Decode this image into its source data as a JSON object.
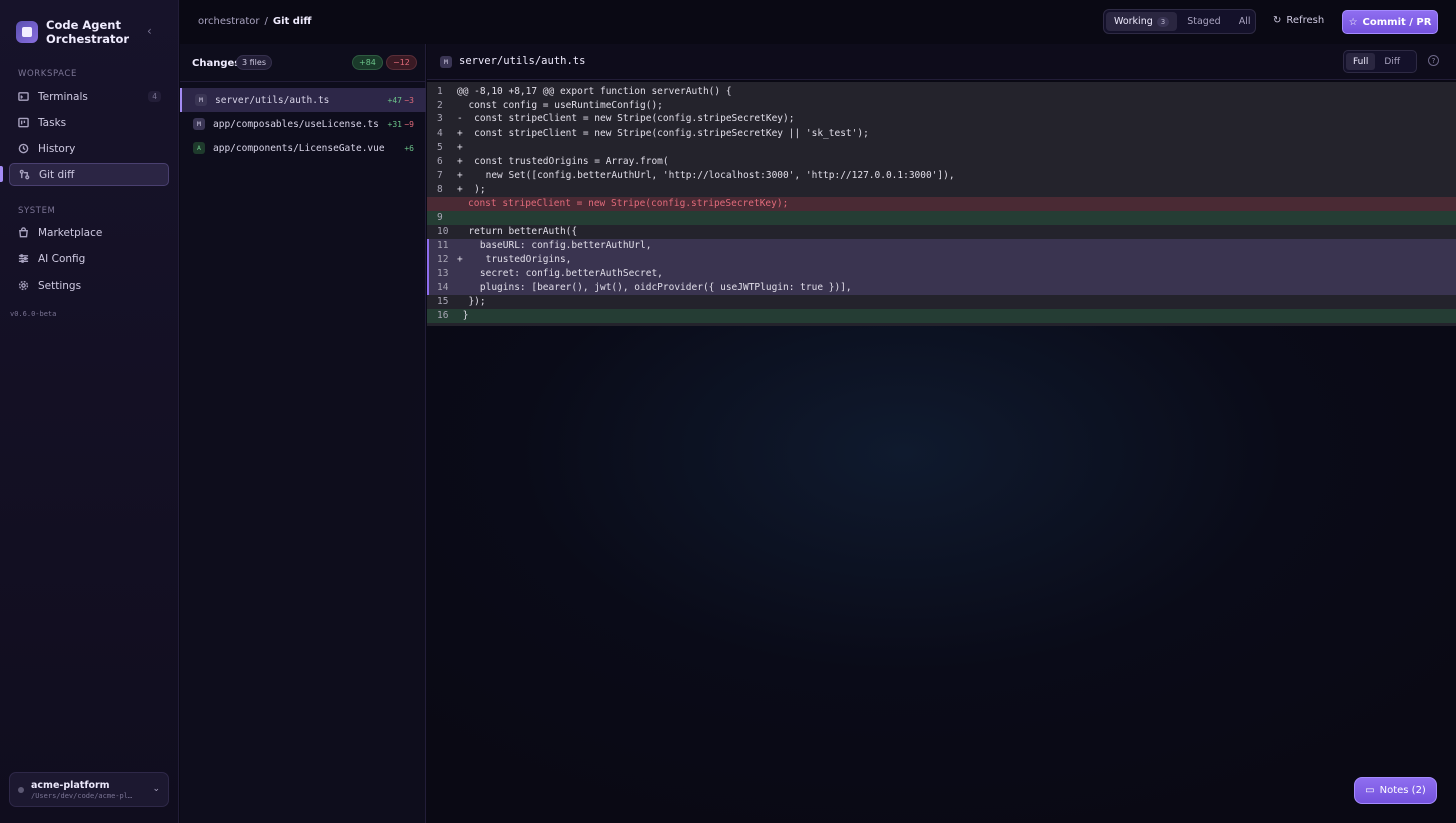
{
  "brand": {
    "name": "Code Agent Orchestrator"
  },
  "sidebar": {
    "workspace_label": "WORKSPACE",
    "system_label": "SYSTEM",
    "items": [
      {
        "label": "Terminals",
        "badge": "4",
        "icon": "terminal-icon"
      },
      {
        "label": "Tasks",
        "icon": "kanban-icon"
      },
      {
        "label": "History",
        "icon": "history-icon"
      },
      {
        "label": "Git diff",
        "icon": "git-diff-icon",
        "active": true
      },
      {
        "label": "Marketplace",
        "icon": "shopping-bag-icon"
      },
      {
        "label": "AI Config",
        "icon": "sliders-icon"
      },
      {
        "label": "Settings",
        "icon": "gear-icon"
      }
    ],
    "version": "v0.6.0-beta",
    "project": {
      "name": "acme-platform",
      "path": "/Users/dev/code/acme-pl…"
    }
  },
  "topbar": {
    "breadcrumb": {
      "root": "orchestrator",
      "sep": "/",
      "current": "Git diff"
    },
    "tabs": [
      {
        "label": "Working",
        "count": "3",
        "active": true
      },
      {
        "label": "Staged"
      },
      {
        "label": "All"
      }
    ],
    "refresh_label": "Refresh",
    "commit_label": "Commit / PR"
  },
  "changes": {
    "title": "Changes",
    "count": "3 files",
    "additions": "+84",
    "deletions": "−12",
    "files": [
      {
        "status": "M",
        "path": "server/utils/auth.ts",
        "add": "+47",
        "del": "−3",
        "active": true
      },
      {
        "status": "M",
        "path": "app/composables/useLicense.ts",
        "add": "+31",
        "del": "−9"
      },
      {
        "status": "A",
        "path": "app/components/LicenseGate.vue",
        "add": "+6"
      }
    ]
  },
  "editor": {
    "status": "M",
    "file": "server/utils/auth.ts",
    "views": [
      "Full",
      "Diff"
    ],
    "help": "?",
    "lines": [
      {
        "n": "1",
        "text": "@@ -8,10 +8,17 @@ export function serverAuth() {"
      },
      {
        "n": "2",
        "text": "  const config = useRuntimeConfig();"
      },
      {
        "n": "3",
        "text": "-  const stripeClient = new Stripe(config.stripeSecretKey);"
      },
      {
        "n": "4",
        "text": "+  const stripeClient = new Stripe(config.stripeSecretKey || 'sk_test');"
      },
      {
        "n": "5",
        "text": "+"
      },
      {
        "n": "6",
        "text": "+  const trustedOrigins = Array.from("
      },
      {
        "n": "7",
        "text": "+    new Set([config.betterAuthUrl, 'http://localhost:3000', 'http://127.0.0.1:3000']),"
      },
      {
        "n": "8",
        "text": "+  );"
      },
      {
        "n": "",
        "text": "const stripeClient = new Stripe(config.stripeSecretKey);",
        "kind": "del"
      },
      {
        "n": "9",
        "text": "",
        "kind": "green"
      },
      {
        "n": "10",
        "text": "  return betterAuth({"
      },
      {
        "n": "11",
        "text": "    baseURL: config.betterAuthUrl,",
        "kind": "hl"
      },
      {
        "n": "12",
        "text": "+    trustedOrigins,",
        "kind": "hl"
      },
      {
        "n": "13",
        "text": "    secret: config.betterAuthSecret,",
        "kind": "hl"
      },
      {
        "n": "14",
        "text": "    plugins: [bearer(), jwt(), oidcProvider({ useJWTPlugin: true })],",
        "kind": "hl"
      },
      {
        "n": "15",
        "text": "  });"
      },
      {
        "n": "16",
        "text": " }",
        "kind": "green"
      }
    ]
  },
  "notes_label": "Notes (2)"
}
